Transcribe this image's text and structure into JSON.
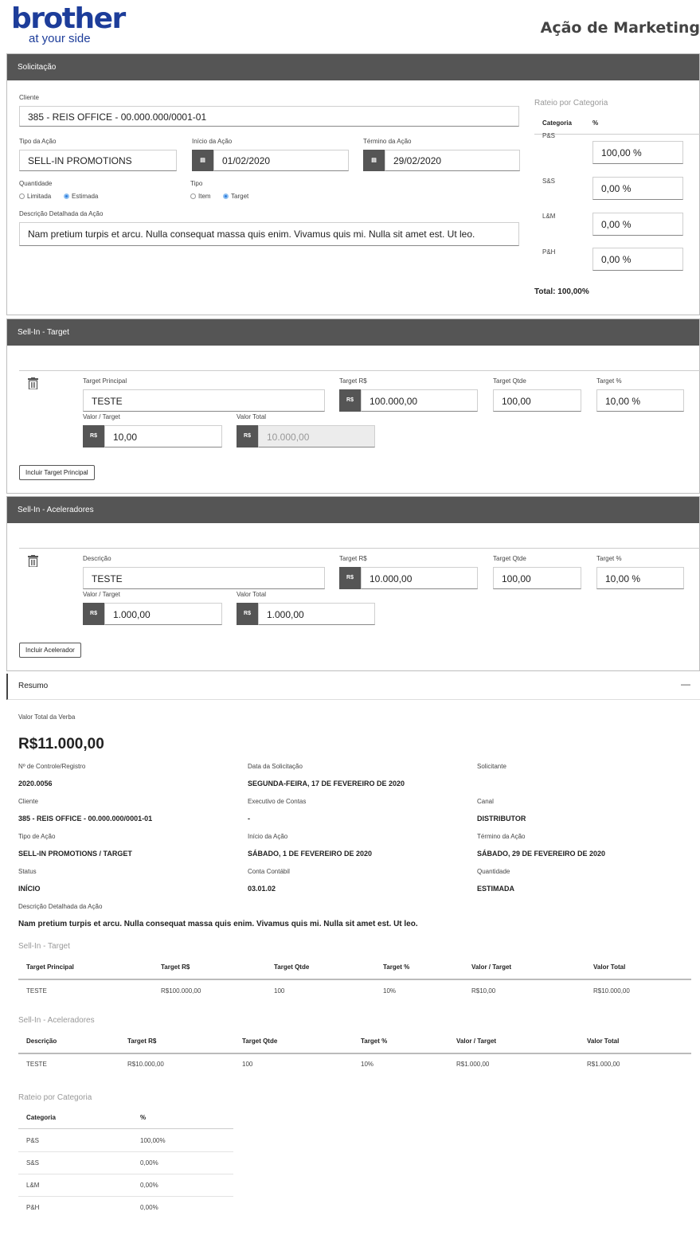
{
  "header": {
    "logo_word": "brother",
    "logo_tagline": "at your side",
    "page_title": "Ação de Marketing"
  },
  "solicitacao": {
    "title": "Solicitação",
    "cliente_label": "Cliente",
    "cliente_value": "385 - REIS OFFICE - 00.000.000/0001-01",
    "tipo_acao_label": "Tipo da Ação",
    "tipo_acao_value": "SELL-IN PROMOTIONS",
    "inicio_label": "Início da Ação",
    "inicio_value": "01/02/2020",
    "termino_label": "Término da Ação",
    "termino_value": "29/02/2020",
    "quantidade_label": "Quantidade",
    "quantidade_options": [
      "Limitada",
      "Estimada"
    ],
    "quantidade_selected": "Estimada",
    "tipo_label": "Tipo",
    "tipo_options": [
      "Item",
      "Target"
    ],
    "tipo_selected": "Target",
    "descricao_label": "Descrição Detalhada da Ação",
    "descricao_value": "Nam pretium turpis et arcu. Nulla consequat massa quis enim. Vivamus quis mi. Nulla sit amet est. Ut leo."
  },
  "rateio_form": {
    "title": "Rateio por Categoria",
    "col_categoria": "Categoria",
    "col_pct": "%",
    "rows": [
      {
        "categoria": "P&S",
        "value": "100,00 %"
      },
      {
        "categoria": "S&S",
        "value": "0,00 %"
      },
      {
        "categoria": "L&M",
        "value": "0,00 %"
      },
      {
        "categoria": "P&H",
        "value": "0,00 %"
      }
    ],
    "total": "Total: 100,00%"
  },
  "sellin_target": {
    "title": "Sell-In - Target",
    "target_principal_label": "Target Principal",
    "target_principal_value": "TESTE",
    "target_rs_label": "Target R$",
    "target_rs_value": "100.000,00",
    "target_qtde_label": "Target Qtde",
    "target_qtde_value": "100,00",
    "target_pct_label": "Target %",
    "target_pct_value": "10,00 %",
    "valor_target_label": "Valor / Target",
    "valor_target_value": "10,00",
    "valor_total_label": "Valor Total",
    "valor_total_value": "10.000,00",
    "currency_addon": "R$",
    "add_button": "Incluir Target Principal"
  },
  "sellin_aceleradores": {
    "title": "Sell-In - Aceleradores",
    "descricao_label": "Descrição",
    "descricao_value": "TESTE",
    "target_rs_label": "Target R$",
    "target_rs_value": "10.000,00",
    "target_qtde_label": "Target Qtde",
    "target_qtde_value": "100,00",
    "target_pct_label": "Target %",
    "target_pct_value": "10,00 %",
    "valor_target_label": "Valor / Target",
    "valor_target_value": "1.000,00",
    "valor_total_label": "Valor Total",
    "valor_total_value": "1.000,00",
    "currency_addon": "R$",
    "add_button": "Incluir Acelerador"
  },
  "resumo": {
    "title": "Resumo",
    "collapse_icon": "—",
    "valor_total_label": "Valor Total da Verba",
    "valor_total_value": "R$11.000,00",
    "fields": {
      "controle_label": "Nº de Controle/Registro",
      "controle_value": "2020.0056",
      "data_label": "Data da Solicitação",
      "data_value": "SEGUNDA-FEIRA, 17 DE FEVEREIRO DE 2020",
      "solicitante_label": "Solicitante",
      "solicitante_value": "",
      "cliente_label": "Cliente",
      "cliente_value": "385 - REIS OFFICE - 00.000.000/0001-01",
      "executivo_label": "Executivo de Contas",
      "executivo_value": "-",
      "canal_label": "Canal",
      "canal_value": "DISTRIBUTOR",
      "tipo_label": "Tipo de Ação",
      "tipo_value": "SELL-IN PROMOTIONS / TARGET",
      "inicio_label": "Início da Ação",
      "inicio_value": "SÁBADO, 1 DE FEVEREIRO DE 2020",
      "termino_label": "Término da Ação",
      "termino_value": "SÁBADO, 29 DE FEVEREIRO DE 2020",
      "status_label": "Status",
      "status_value": "INÍCIO",
      "conta_label": "Conta Contábil",
      "conta_value": "03.01.02",
      "quantidade_label": "Quantidade",
      "quantidade_value": "ESTIMADA",
      "descricao_label": "Descrição Detalhada da Ação",
      "descricao_value": "Nam pretium turpis et arcu. Nulla consequat massa quis enim. Vivamus quis mi. Nulla sit amet est. Ut leo."
    },
    "target_table": {
      "title": "Sell-In - Target",
      "headers": [
        "Target Principal",
        "Target R$",
        "Target Qtde",
        "Target %",
        "Valor / Target",
        "Valor Total"
      ],
      "row": [
        "TESTE",
        "R$100.000,00",
        "100",
        "10%",
        "R$10,00",
        "R$10.000,00"
      ]
    },
    "acel_table": {
      "title": "Sell-In - Aceleradores",
      "headers": [
        "Descrição",
        "Target R$",
        "Target Qtde",
        "Target %",
        "Valor / Target",
        "Valor Total"
      ],
      "row": [
        "TESTE",
        "R$10.000,00",
        "100",
        "10%",
        "R$1.000,00",
        "R$1.000,00"
      ]
    },
    "rateio_table": {
      "title": "Rateio por Categoria",
      "headers": [
        "Categoria",
        "%"
      ],
      "rows": [
        [
          "P&S",
          "100,00%"
        ],
        [
          "S&S",
          "0,00%"
        ],
        [
          "L&M",
          "0,00%"
        ],
        [
          "P&H",
          "0,00%"
        ]
      ]
    }
  },
  "colors": {
    "header_bg": "#555555",
    "brand_blue": "#1d3d9a",
    "radio_on": "#2f7fe0"
  }
}
